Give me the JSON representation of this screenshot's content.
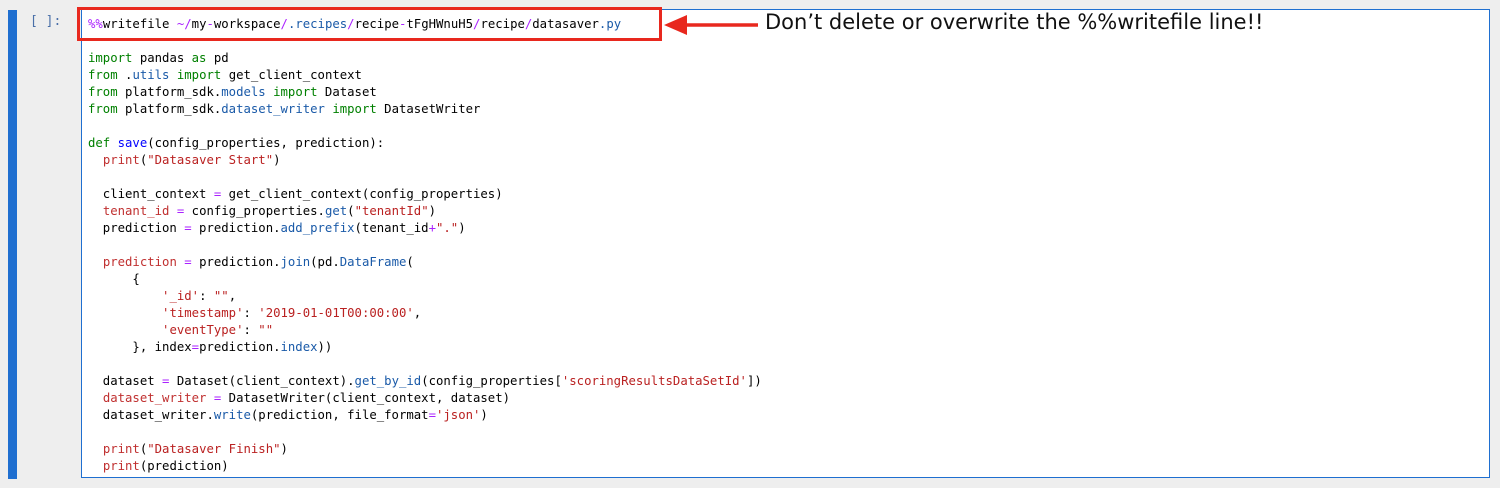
{
  "cell": {
    "prompt": "[ ]:",
    "lines": [
      [
        {
          "t": "%%",
          "c": "magic"
        },
        {
          "t": "writefile ",
          "c": "plain"
        },
        {
          "t": "~",
          "c": "op"
        },
        {
          "t": "/",
          "c": "op"
        },
        {
          "t": "my",
          "c": "plain"
        },
        {
          "t": "-",
          "c": "op"
        },
        {
          "t": "workspace",
          "c": "plain"
        },
        {
          "t": "/",
          "c": "op"
        },
        {
          "t": ".recipes",
          "c": "attr"
        },
        {
          "t": "/",
          "c": "op"
        },
        {
          "t": "recipe",
          "c": "plain"
        },
        {
          "t": "-",
          "c": "op"
        },
        {
          "t": "tFgHWnuH5",
          "c": "plain"
        },
        {
          "t": "/",
          "c": "op"
        },
        {
          "t": "recipe",
          "c": "plain"
        },
        {
          "t": "/",
          "c": "op"
        },
        {
          "t": "datasaver",
          "c": "plain"
        },
        {
          "t": ".py",
          "c": "attr"
        }
      ],
      [],
      [
        {
          "t": "import",
          "c": "kw"
        },
        {
          "t": " pandas ",
          "c": "plain"
        },
        {
          "t": "as",
          "c": "kw"
        },
        {
          "t": " pd",
          "c": "plain"
        }
      ],
      [
        {
          "t": "from",
          "c": "kw"
        },
        {
          "t": " .",
          "c": "plain"
        },
        {
          "t": "utils",
          "c": "attr"
        },
        {
          "t": " ",
          "c": "plain"
        },
        {
          "t": "import",
          "c": "kw"
        },
        {
          "t": " get_client_context",
          "c": "plain"
        }
      ],
      [
        {
          "t": "from",
          "c": "kw"
        },
        {
          "t": " platform_sdk.",
          "c": "plain"
        },
        {
          "t": "models",
          "c": "attr"
        },
        {
          "t": " ",
          "c": "plain"
        },
        {
          "t": "import",
          "c": "kw"
        },
        {
          "t": " Dataset",
          "c": "plain"
        }
      ],
      [
        {
          "t": "from",
          "c": "kw"
        },
        {
          "t": " platform_sdk.",
          "c": "plain"
        },
        {
          "t": "dataset_writer",
          "c": "attr"
        },
        {
          "t": " ",
          "c": "plain"
        },
        {
          "t": "import",
          "c": "kw"
        },
        {
          "t": " DatasetWriter",
          "c": "plain"
        }
      ],
      [],
      [
        {
          "t": "def",
          "c": "kw"
        },
        {
          "t": " ",
          "c": "plain"
        },
        {
          "t": "save",
          "c": "fn"
        },
        {
          "t": "(config_properties, prediction):",
          "c": "plain"
        }
      ],
      [
        {
          "t": "  ",
          "c": "plain"
        },
        {
          "t": "print",
          "c": "var"
        },
        {
          "t": "(",
          "c": "plain"
        },
        {
          "t": "\"Datasaver Start\"",
          "c": "str"
        },
        {
          "t": ")",
          "c": "plain"
        }
      ],
      [],
      [
        {
          "t": "  client_context ",
          "c": "plain"
        },
        {
          "t": "=",
          "c": "op"
        },
        {
          "t": " get_client_context(config_properties)",
          "c": "plain"
        }
      ],
      [
        {
          "t": "  ",
          "c": "plain"
        },
        {
          "t": "tenant_id",
          "c": "var"
        },
        {
          "t": " ",
          "c": "plain"
        },
        {
          "t": "=",
          "c": "op"
        },
        {
          "t": " config_properties.",
          "c": "plain"
        },
        {
          "t": "get",
          "c": "attr"
        },
        {
          "t": "(",
          "c": "plain"
        },
        {
          "t": "\"tenantId\"",
          "c": "str"
        },
        {
          "t": ")",
          "c": "plain"
        }
      ],
      [
        {
          "t": "  prediction ",
          "c": "plain"
        },
        {
          "t": "=",
          "c": "op"
        },
        {
          "t": " prediction.",
          "c": "plain"
        },
        {
          "t": "add_prefix",
          "c": "attr"
        },
        {
          "t": "(tenant_id",
          "c": "plain"
        },
        {
          "t": "+",
          "c": "op"
        },
        {
          "t": "\".\"",
          "c": "str"
        },
        {
          "t": ")",
          "c": "plain"
        }
      ],
      [],
      [
        {
          "t": "  ",
          "c": "plain"
        },
        {
          "t": "prediction",
          "c": "var"
        },
        {
          "t": " ",
          "c": "plain"
        },
        {
          "t": "=",
          "c": "op"
        },
        {
          "t": " prediction.",
          "c": "plain"
        },
        {
          "t": "join",
          "c": "attr"
        },
        {
          "t": "(pd.",
          "c": "plain"
        },
        {
          "t": "DataFrame",
          "c": "attr"
        },
        {
          "t": "(",
          "c": "plain"
        }
      ],
      [
        {
          "t": "      {",
          "c": "plain"
        }
      ],
      [
        {
          "t": "          ",
          "c": "plain"
        },
        {
          "t": "'_id'",
          "c": "str"
        },
        {
          "t": ": ",
          "c": "plain"
        },
        {
          "t": "\"\"",
          "c": "str"
        },
        {
          "t": ",",
          "c": "plain"
        }
      ],
      [
        {
          "t": "          ",
          "c": "plain"
        },
        {
          "t": "'timestamp'",
          "c": "str"
        },
        {
          "t": ": ",
          "c": "plain"
        },
        {
          "t": "'2019-01-01T00:00:00'",
          "c": "str"
        },
        {
          "t": ",",
          "c": "plain"
        }
      ],
      [
        {
          "t": "          ",
          "c": "plain"
        },
        {
          "t": "'eventType'",
          "c": "str"
        },
        {
          "t": ": ",
          "c": "plain"
        },
        {
          "t": "\"\"",
          "c": "str"
        }
      ],
      [
        {
          "t": "      }, index",
          "c": "plain"
        },
        {
          "t": "=",
          "c": "op"
        },
        {
          "t": "prediction.",
          "c": "plain"
        },
        {
          "t": "index",
          "c": "attr"
        },
        {
          "t": "))",
          "c": "plain"
        }
      ],
      [],
      [
        {
          "t": "  dataset ",
          "c": "plain"
        },
        {
          "t": "=",
          "c": "op"
        },
        {
          "t": " Dataset(client_context).",
          "c": "plain"
        },
        {
          "t": "get_by_id",
          "c": "attr"
        },
        {
          "t": "(config_properties[",
          "c": "plain"
        },
        {
          "t": "'scoringResultsDataSetId'",
          "c": "str"
        },
        {
          "t": "])",
          "c": "plain"
        }
      ],
      [
        {
          "t": "  ",
          "c": "plain"
        },
        {
          "t": "dataset_writer",
          "c": "var"
        },
        {
          "t": " ",
          "c": "plain"
        },
        {
          "t": "=",
          "c": "op"
        },
        {
          "t": " DatasetWriter(client_context, dataset)",
          "c": "plain"
        }
      ],
      [
        {
          "t": "  dataset_writer.",
          "c": "plain"
        },
        {
          "t": "write",
          "c": "attr"
        },
        {
          "t": "(prediction, file_format",
          "c": "plain"
        },
        {
          "t": "=",
          "c": "op"
        },
        {
          "t": "'json'",
          "c": "str"
        },
        {
          "t": ")",
          "c": "plain"
        }
      ],
      [],
      [
        {
          "t": "  ",
          "c": "plain"
        },
        {
          "t": "print",
          "c": "var"
        },
        {
          "t": "(",
          "c": "plain"
        },
        {
          "t": "\"Datasaver Finish\"",
          "c": "str"
        },
        {
          "t": ")",
          "c": "plain"
        }
      ],
      [
        {
          "t": "  ",
          "c": "plain"
        },
        {
          "t": "print",
          "c": "var"
        },
        {
          "t": "(prediction)",
          "c": "plain"
        }
      ]
    ]
  },
  "annotation": {
    "text": "Don’t delete or overwrite the %%writefile line!!",
    "highlight_color": "#e8281e"
  },
  "colors": {
    "cell_border": "#1f6fd0",
    "keyword": "#008000",
    "string": "#ba2121"
  }
}
